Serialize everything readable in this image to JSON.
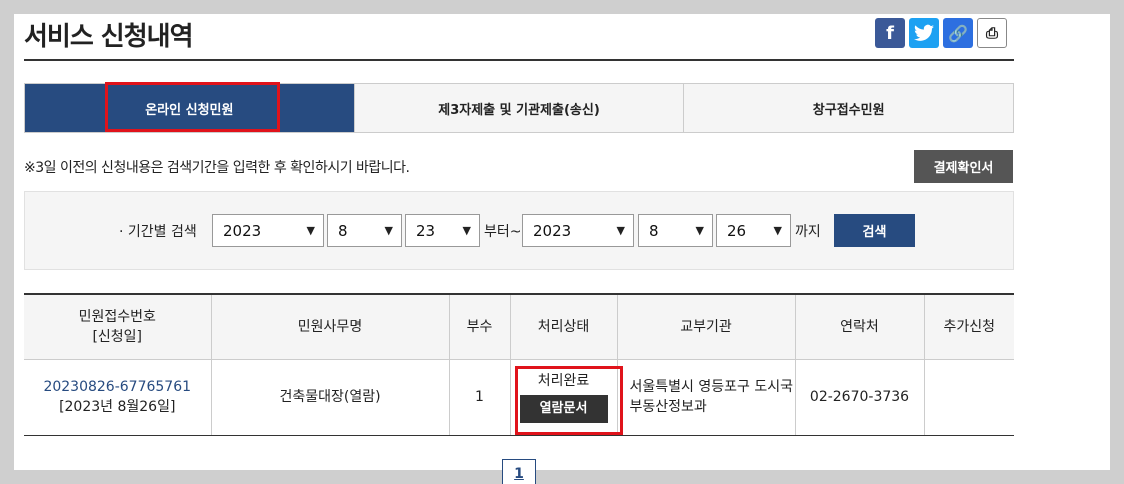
{
  "header": {
    "title": "서비스 신청내역",
    "share_icons": [
      "facebook-icon",
      "twitter-icon",
      "link-icon",
      "print-icon"
    ],
    "facebook_glyph": "f",
    "link_glyph": "🔗",
    "print_glyph": "⎙"
  },
  "tabs": [
    {
      "label": "온라인 신청민원",
      "active": true
    },
    {
      "label": "제3자제출 및 기관제출(송신)",
      "active": false
    },
    {
      "label": "창구접수민원",
      "active": false
    }
  ],
  "notice": "※3일 이전의 신청내용은 검색기간을 입력한 후 확인하시기 바랍니다.",
  "payment_button": "결제확인서",
  "search": {
    "label": "· 기간별 검색",
    "from_year": "2023",
    "from_month": "8",
    "from_day": "23",
    "from_suffix": "부터~",
    "to_year": "2023",
    "to_month": "8",
    "to_day": "26",
    "to_suffix": "까지",
    "button": "검색"
  },
  "table": {
    "headers": [
      "민원접수번호",
      "[신청일]",
      "민원사무명",
      "부수",
      "처리상태",
      "교부기관",
      "연락처",
      "추가신청"
    ],
    "rows": [
      {
        "receipt_no": "20230826-67765761",
        "date": "[2023년 8월26일]",
        "service": "건축물대장(열람)",
        "copies": "1",
        "status": "처리완료",
        "view_button": "열람문서",
        "agency_line1": "서울특별시 영등포구 도시국",
        "agency_line2": "부동산정보과",
        "contact": "02-2670-3736",
        "extra": ""
      }
    ]
  },
  "pagination": {
    "current": "1"
  },
  "colors": {
    "primary": "#274b80",
    "highlight": "#e0131b",
    "dark_button": "#555555"
  }
}
